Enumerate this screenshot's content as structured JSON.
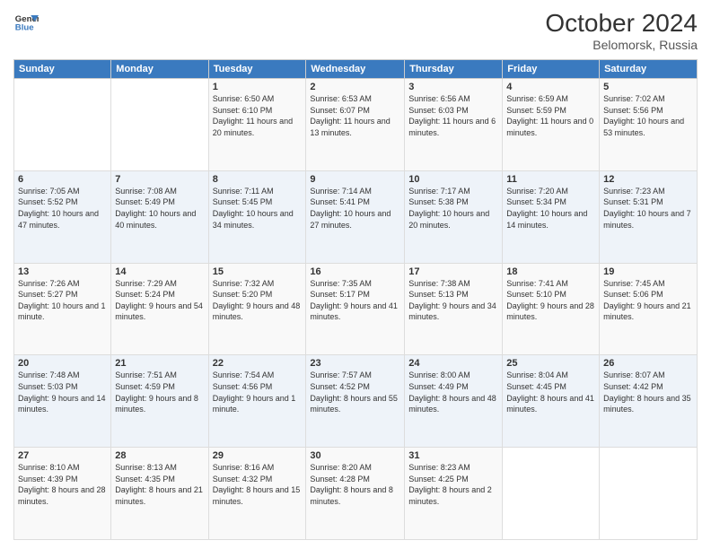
{
  "header": {
    "logo_line1": "General",
    "logo_line2": "Blue",
    "month": "October 2024",
    "location": "Belomorsk, Russia"
  },
  "weekdays": [
    "Sunday",
    "Monday",
    "Tuesday",
    "Wednesday",
    "Thursday",
    "Friday",
    "Saturday"
  ],
  "weeks": [
    [
      {
        "day": "",
        "sunrise": "",
        "sunset": "",
        "daylight": ""
      },
      {
        "day": "",
        "sunrise": "",
        "sunset": "",
        "daylight": ""
      },
      {
        "day": "1",
        "sunrise": "Sunrise: 6:50 AM",
        "sunset": "Sunset: 6:10 PM",
        "daylight": "Daylight: 11 hours and 20 minutes."
      },
      {
        "day": "2",
        "sunrise": "Sunrise: 6:53 AM",
        "sunset": "Sunset: 6:07 PM",
        "daylight": "Daylight: 11 hours and 13 minutes."
      },
      {
        "day": "3",
        "sunrise": "Sunrise: 6:56 AM",
        "sunset": "Sunset: 6:03 PM",
        "daylight": "Daylight: 11 hours and 6 minutes."
      },
      {
        "day": "4",
        "sunrise": "Sunrise: 6:59 AM",
        "sunset": "Sunset: 5:59 PM",
        "daylight": "Daylight: 11 hours and 0 minutes."
      },
      {
        "day": "5",
        "sunrise": "Sunrise: 7:02 AM",
        "sunset": "Sunset: 5:56 PM",
        "daylight": "Daylight: 10 hours and 53 minutes."
      }
    ],
    [
      {
        "day": "6",
        "sunrise": "Sunrise: 7:05 AM",
        "sunset": "Sunset: 5:52 PM",
        "daylight": "Daylight: 10 hours and 47 minutes."
      },
      {
        "day": "7",
        "sunrise": "Sunrise: 7:08 AM",
        "sunset": "Sunset: 5:49 PM",
        "daylight": "Daylight: 10 hours and 40 minutes."
      },
      {
        "day": "8",
        "sunrise": "Sunrise: 7:11 AM",
        "sunset": "Sunset: 5:45 PM",
        "daylight": "Daylight: 10 hours and 34 minutes."
      },
      {
        "day": "9",
        "sunrise": "Sunrise: 7:14 AM",
        "sunset": "Sunset: 5:41 PM",
        "daylight": "Daylight: 10 hours and 27 minutes."
      },
      {
        "day": "10",
        "sunrise": "Sunrise: 7:17 AM",
        "sunset": "Sunset: 5:38 PM",
        "daylight": "Daylight: 10 hours and 20 minutes."
      },
      {
        "day": "11",
        "sunrise": "Sunrise: 7:20 AM",
        "sunset": "Sunset: 5:34 PM",
        "daylight": "Daylight: 10 hours and 14 minutes."
      },
      {
        "day": "12",
        "sunrise": "Sunrise: 7:23 AM",
        "sunset": "Sunset: 5:31 PM",
        "daylight": "Daylight: 10 hours and 7 minutes."
      }
    ],
    [
      {
        "day": "13",
        "sunrise": "Sunrise: 7:26 AM",
        "sunset": "Sunset: 5:27 PM",
        "daylight": "Daylight: 10 hours and 1 minute."
      },
      {
        "day": "14",
        "sunrise": "Sunrise: 7:29 AM",
        "sunset": "Sunset: 5:24 PM",
        "daylight": "Daylight: 9 hours and 54 minutes."
      },
      {
        "day": "15",
        "sunrise": "Sunrise: 7:32 AM",
        "sunset": "Sunset: 5:20 PM",
        "daylight": "Daylight: 9 hours and 48 minutes."
      },
      {
        "day": "16",
        "sunrise": "Sunrise: 7:35 AM",
        "sunset": "Sunset: 5:17 PM",
        "daylight": "Daylight: 9 hours and 41 minutes."
      },
      {
        "day": "17",
        "sunrise": "Sunrise: 7:38 AM",
        "sunset": "Sunset: 5:13 PM",
        "daylight": "Daylight: 9 hours and 34 minutes."
      },
      {
        "day": "18",
        "sunrise": "Sunrise: 7:41 AM",
        "sunset": "Sunset: 5:10 PM",
        "daylight": "Daylight: 9 hours and 28 minutes."
      },
      {
        "day": "19",
        "sunrise": "Sunrise: 7:45 AM",
        "sunset": "Sunset: 5:06 PM",
        "daylight": "Daylight: 9 hours and 21 minutes."
      }
    ],
    [
      {
        "day": "20",
        "sunrise": "Sunrise: 7:48 AM",
        "sunset": "Sunset: 5:03 PM",
        "daylight": "Daylight: 9 hours and 14 minutes."
      },
      {
        "day": "21",
        "sunrise": "Sunrise: 7:51 AM",
        "sunset": "Sunset: 4:59 PM",
        "daylight": "Daylight: 9 hours and 8 minutes."
      },
      {
        "day": "22",
        "sunrise": "Sunrise: 7:54 AM",
        "sunset": "Sunset: 4:56 PM",
        "daylight": "Daylight: 9 hours and 1 minute."
      },
      {
        "day": "23",
        "sunrise": "Sunrise: 7:57 AM",
        "sunset": "Sunset: 4:52 PM",
        "daylight": "Daylight: 8 hours and 55 minutes."
      },
      {
        "day": "24",
        "sunrise": "Sunrise: 8:00 AM",
        "sunset": "Sunset: 4:49 PM",
        "daylight": "Daylight: 8 hours and 48 minutes."
      },
      {
        "day": "25",
        "sunrise": "Sunrise: 8:04 AM",
        "sunset": "Sunset: 4:45 PM",
        "daylight": "Daylight: 8 hours and 41 minutes."
      },
      {
        "day": "26",
        "sunrise": "Sunrise: 8:07 AM",
        "sunset": "Sunset: 4:42 PM",
        "daylight": "Daylight: 8 hours and 35 minutes."
      }
    ],
    [
      {
        "day": "27",
        "sunrise": "Sunrise: 8:10 AM",
        "sunset": "Sunset: 4:39 PM",
        "daylight": "Daylight: 8 hours and 28 minutes."
      },
      {
        "day": "28",
        "sunrise": "Sunrise: 8:13 AM",
        "sunset": "Sunset: 4:35 PM",
        "daylight": "Daylight: 8 hours and 21 minutes."
      },
      {
        "day": "29",
        "sunrise": "Sunrise: 8:16 AM",
        "sunset": "Sunset: 4:32 PM",
        "daylight": "Daylight: 8 hours and 15 minutes."
      },
      {
        "day": "30",
        "sunrise": "Sunrise: 8:20 AM",
        "sunset": "Sunset: 4:28 PM",
        "daylight": "Daylight: 8 hours and 8 minutes."
      },
      {
        "day": "31",
        "sunrise": "Sunrise: 8:23 AM",
        "sunset": "Sunset: 4:25 PM",
        "daylight": "Daylight: 8 hours and 2 minutes."
      },
      {
        "day": "",
        "sunrise": "",
        "sunset": "",
        "daylight": ""
      },
      {
        "day": "",
        "sunrise": "",
        "sunset": "",
        "daylight": ""
      }
    ]
  ]
}
